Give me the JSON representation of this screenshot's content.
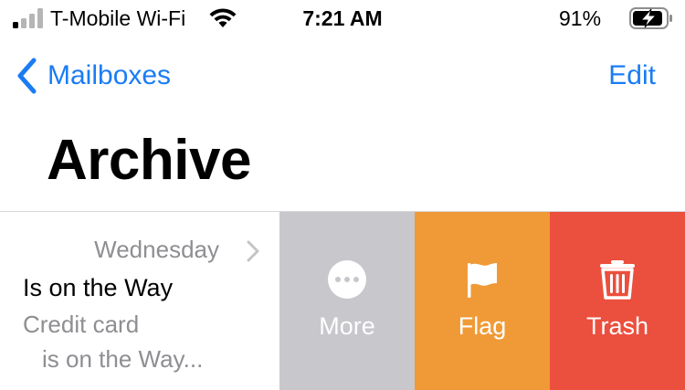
{
  "status_bar": {
    "carrier": "T-Mobile Wi-Fi",
    "time": "7:21 AM",
    "battery_percent": "91%"
  },
  "nav": {
    "back_label": "Mailboxes",
    "edit_label": "Edit"
  },
  "page_title": "Archive",
  "message": {
    "date": "Wednesday",
    "sender": "Is on the Way",
    "preview_line1": "Credit card",
    "preview_line2": "is on the Way..."
  },
  "swipe_actions": [
    {
      "label": "More",
      "color": "#c7c7cc",
      "icon": "ellipsis-circle-icon"
    },
    {
      "label": "Flag",
      "color": "#f09a37",
      "icon": "flag-icon"
    },
    {
      "label": "Trash",
      "color": "#eb4f3d",
      "icon": "trash-icon"
    }
  ],
  "colors": {
    "accent": "#1a7cf5",
    "secondary_text": "#8e8e93"
  }
}
